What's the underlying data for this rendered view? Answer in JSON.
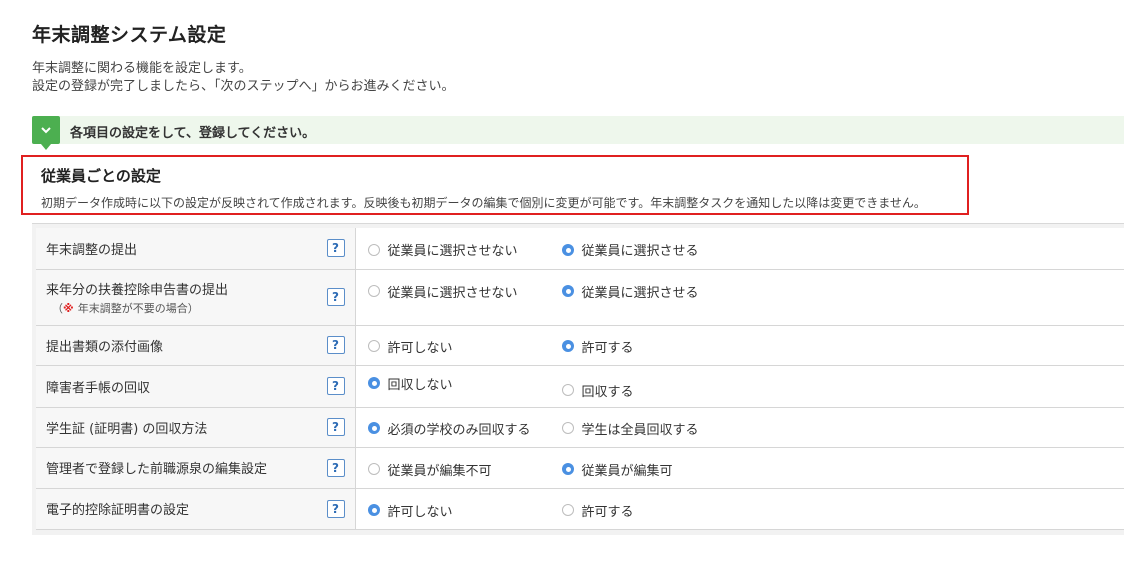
{
  "page": {
    "title": "年末調整システム設定",
    "description_line1": "年末調整に関わる機能を設定します。",
    "description_line2": "設定の登録が完了しましたら、「次のステップへ」からお進みください。"
  },
  "guide": {
    "text": "各項目の設定をして、登録してください。",
    "icon": "chevron-down-icon"
  },
  "section": {
    "title": "従業員ごとの設定",
    "note": "初期データ作成時に以下の設定が反映されて作成されます。反映後も初期データの編集で個別に変更が可能です。年末調整タスクを通知した以降は変更できません。"
  },
  "settings": [
    {
      "label": "年末調整の提出",
      "sub_mark": "",
      "sub_text": "",
      "help": "?",
      "options": [
        {
          "label": "従業員に選択させない",
          "selected": false
        },
        {
          "label": "従業員に選択させる",
          "selected": true
        }
      ]
    },
    {
      "label": "来年分の扶養控除申告書の提出",
      "sub_mark": "※",
      "sub_text": "年末調整が不要の場合）",
      "sub_prefix": "（",
      "help": "?",
      "options": [
        {
          "label": "従業員に選択させない",
          "selected": false
        },
        {
          "label": "従業員に選択させる",
          "selected": true
        }
      ]
    },
    {
      "label": "提出書類の添付画像",
      "sub_mark": "",
      "sub_text": "",
      "help": "?",
      "options": [
        {
          "label": "許可しない",
          "selected": false
        },
        {
          "label": "許可する",
          "selected": true
        }
      ]
    },
    {
      "label": "障害者手帳の回収",
      "sub_mark": "",
      "sub_text": "",
      "help": "?",
      "options": [
        {
          "label": "回収しない",
          "selected": true
        },
        {
          "label": "回収する",
          "selected": false
        }
      ]
    },
    {
      "label": "学生証 (証明書) の回収方法",
      "sub_mark": "",
      "sub_text": "",
      "help": "?",
      "options": [
        {
          "label": "必須の学校のみ回収する",
          "selected": true
        },
        {
          "label": "学生は全員回収する",
          "selected": false
        }
      ]
    },
    {
      "label": "管理者で登録した前職源泉の編集設定",
      "sub_mark": "",
      "sub_text": "",
      "help": "?",
      "options": [
        {
          "label": "従業員が編集不可",
          "selected": false
        },
        {
          "label": "従業員が編集可",
          "selected": true
        }
      ]
    },
    {
      "label": "電子的控除証明書の設定",
      "sub_mark": "",
      "sub_text": "",
      "help": "?",
      "options": [
        {
          "label": "許可しない",
          "selected": true
        },
        {
          "label": "許可する",
          "selected": false
        }
      ]
    }
  ],
  "colors": {
    "accent": "#4a90e2",
    "guide": "#4caf50",
    "highlight": "#e02020"
  }
}
